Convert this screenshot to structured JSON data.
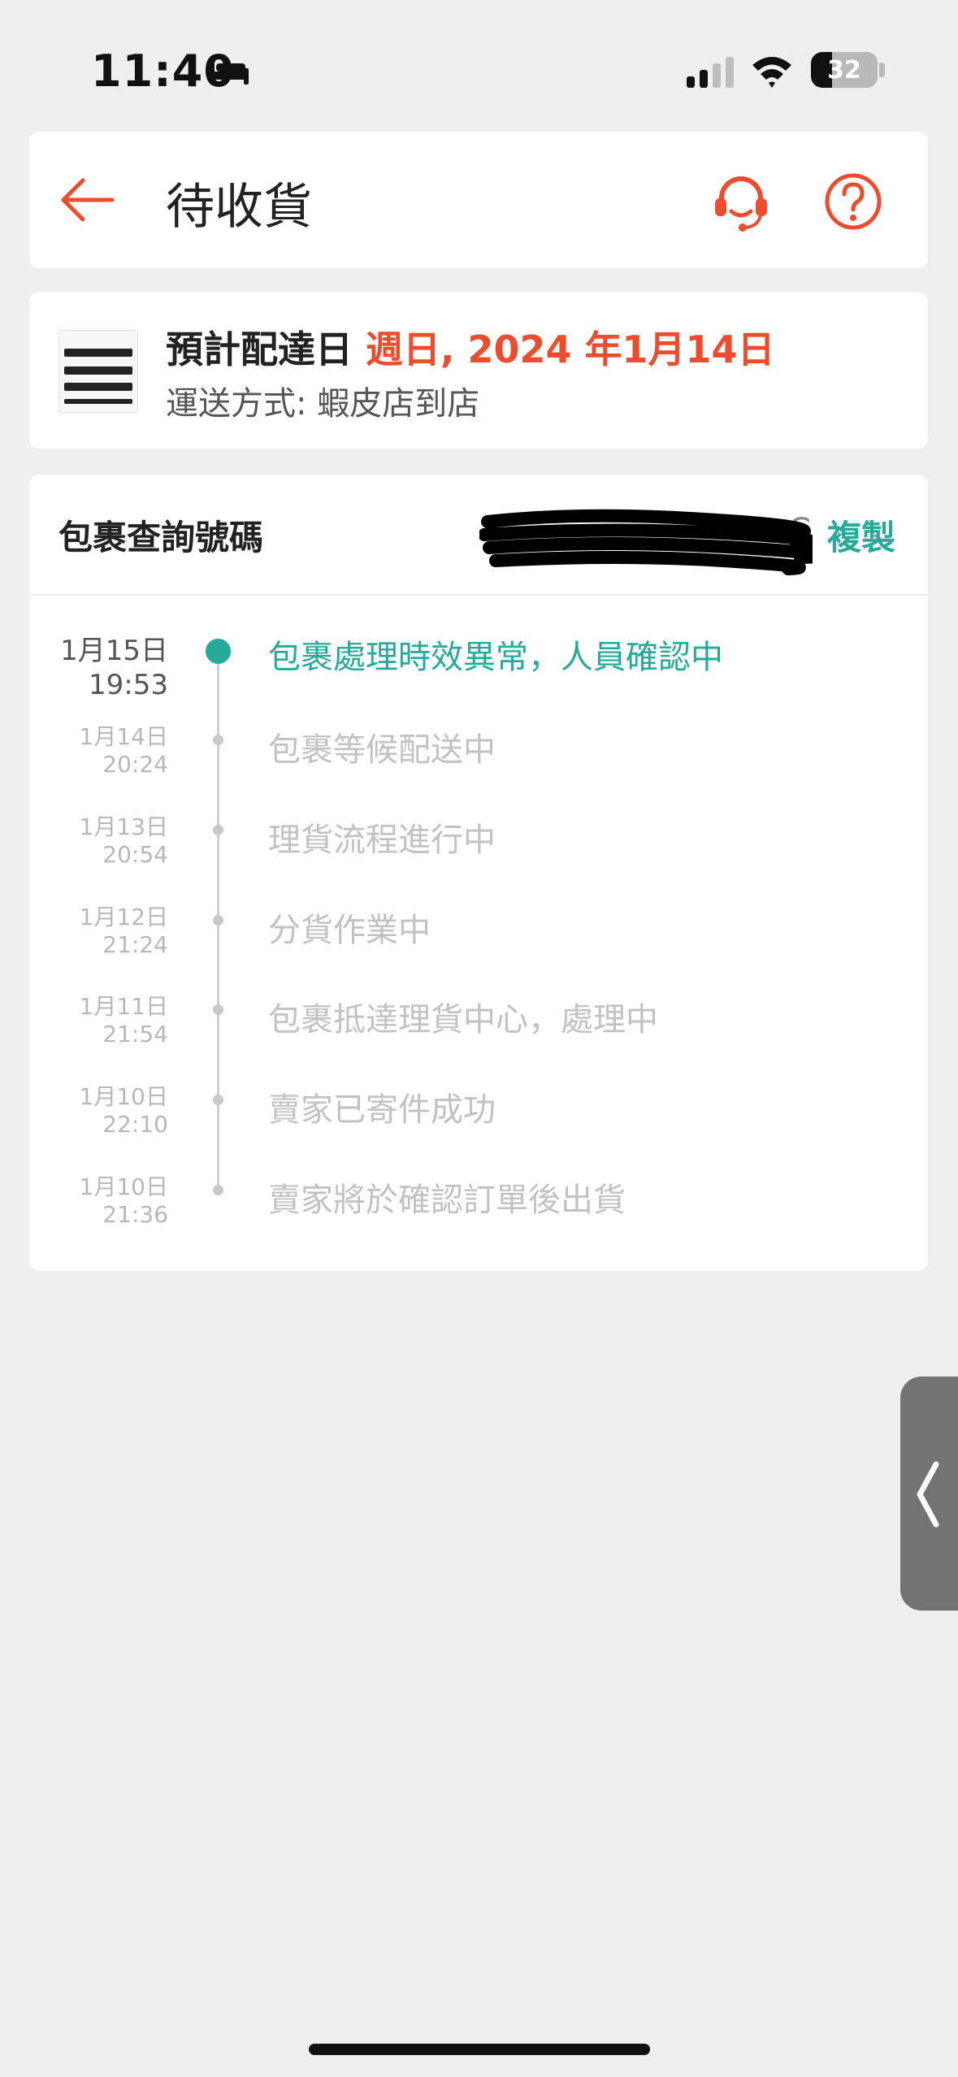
{
  "status_bar": {
    "time": "11:40",
    "battery": "32",
    "battery_level": 0.32,
    "icons": [
      "bed-icon",
      "signal-icon",
      "wifi-icon",
      "battery-icon"
    ]
  },
  "header": {
    "title": "待收貨",
    "icons": [
      "back-arrow-icon",
      "customer-service-icon",
      "help-icon"
    ]
  },
  "delivery": {
    "eta_label": "預計配達日",
    "eta_date": "週日, 2024 年1月14日",
    "shipping_method": "運送方式: 蝦皮店到店"
  },
  "tracking": {
    "label": "包裹查詢號碼",
    "number_visible_suffix": "C",
    "copy_label": "複製"
  },
  "events": [
    {
      "date": "1月15日",
      "time": "19:53",
      "text": "包裹處理時效異常，人員確認中",
      "active": true
    },
    {
      "date": "1月14日",
      "time": "20:24",
      "text": "包裹等候配送中",
      "active": false
    },
    {
      "date": "1月13日",
      "time": "20:54",
      "text": "理貨流程進行中",
      "active": false
    },
    {
      "date": "1月12日",
      "time": "21:24",
      "text": "分貨作業中",
      "active": false
    },
    {
      "date": "1月11日",
      "time": "21:54",
      "text": "包裹抵達理貨中心，處理中",
      "active": false
    },
    {
      "date": "1月10日",
      "time": "22:10",
      "text": "賣家已寄件成功",
      "active": false
    },
    {
      "date": "1月10日",
      "time": "21:36",
      "text": "賣家將於確認訂單後出貨",
      "active": false
    }
  ],
  "colors": {
    "brand_orange": "#ee4d2d",
    "teal": "#26aa99",
    "background": "#efefef"
  }
}
